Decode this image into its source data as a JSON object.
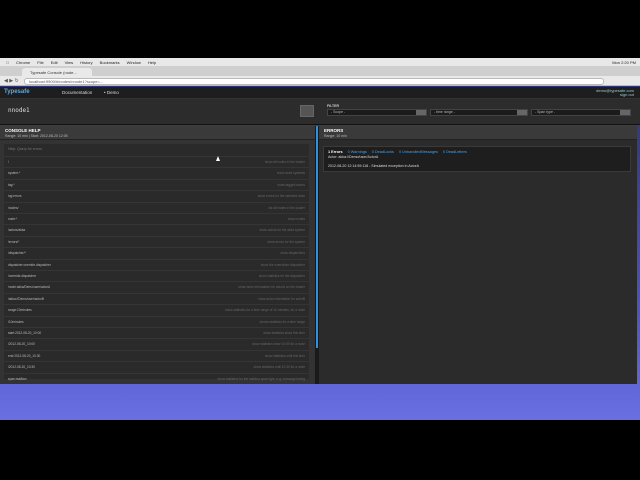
{
  "os_menu": {
    "items": [
      "Chrome",
      "File",
      "Edit",
      "View",
      "History",
      "Bookmarks",
      "Window",
      "Help"
    ],
    "clock": "Mon 2:20 PM"
  },
  "browser": {
    "tab_title": "Typesafe Console (node...",
    "address": "localhost:9900/#/nodes/nnode1?scope=..."
  },
  "app": {
    "logo": "Typesafe",
    "nav": [
      "Documentation",
      "Demo"
    ],
    "user": [
      "demo@typesafe.com",
      "sign out"
    ]
  },
  "nodebar": {
    "node_name": "nnode1",
    "filter_label": "FILTER",
    "scope_select": "- Scope -",
    "time_select": "- time range -",
    "span_select": "- Span type -"
  },
  "console_help": {
    "title": "CONSOLE HELP",
    "subtitle": "Range: 10 min | Start: 2012-08-20 12:05",
    "hint": "Help: Query for errors",
    "rows": [
      {
        "cmd": "/",
        "desc": "show all nodes in the cluster"
      },
      {
        "cmd": "system:*",
        "desc": "show actor systems"
      },
      {
        "cmd": "tag:*",
        "desc": "show tagged actors"
      },
      {
        "cmd": "log:errors",
        "desc": "show errors for the selected node"
      },
      {
        "cmd": "/nodes/",
        "desc": "list all nodes in the cluster"
      },
      {
        "cmd": "node:*",
        "desc": "show nodes"
      },
      {
        "cmd": "/actors/akka",
        "desc": "show actors for the akka system"
      },
      {
        "cmd": "/errors/*",
        "desc": "show errors for the system"
      },
      {
        "cmd": "/dispatcher/*",
        "desc": "show dispatchers"
      },
      {
        "cmd": "dispatcher:override-dispatcher",
        "desc": "show the overridden dispatcher"
      },
      {
        "cmd": "/override-dispatcher",
        "desc": "show statistics for the dispatcher"
      },
      {
        "cmd": "/node:akka/Demo/user/actorA",
        "desc": "show actor information for actorA on the cluster"
      },
      {
        "cmd": "/akka://Demo/user/actorB",
        "desc": "show actor information for actorB"
      },
      {
        "cmd": "range:10minutes",
        "desc": "show statistics for a time range of 10 minutes, for a node"
      },
      {
        "cmd": "/10minutes",
        "desc": "shows statistics for a time range"
      },
      {
        "cmd": "start:2012-08-20_10:00",
        "desc": "show statistics since this time"
      },
      {
        "cmd": "/2012-08-20_10:00",
        "desc": "show statistics since 10:00 for a node"
      },
      {
        "cmd": "end:2012-08-20_10:30",
        "desc": "show statistics until this time"
      },
      {
        "cmd": "/2012-08-20_10:30",
        "desc": "show statistics until 10:30 for a node"
      },
      {
        "cmd": "span:mailbox",
        "desc": "show statistics for the mailbox span type, e.g. message timing"
      }
    ]
  },
  "errors": {
    "title": "ERRORS",
    "subtitle": "Range: 10 min",
    "counts": [
      "1 Errors",
      "0 Warnings",
      "0 DeadLocks",
      "0 UnhandledMessages",
      "0 DeadLetters"
    ],
    "actor": "Actor: akka://Demo/user/ActorA",
    "message": "2012-08-20 12:14:59:118 - Simulated exception in ActorA"
  }
}
